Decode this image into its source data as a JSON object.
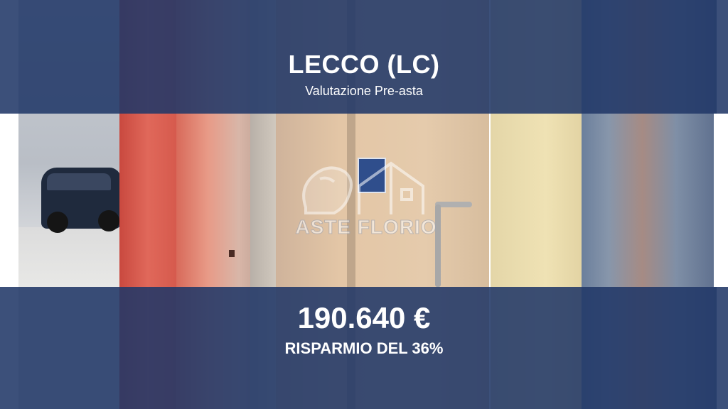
{
  "listing": {
    "location": "LECCO (LC)",
    "subtitle": "Valutazione Pre-asta",
    "price": "190.640 €",
    "saving": "RISPARMIO DEL 36%"
  },
  "watermark": {
    "brand": "ASTE FLORIO",
    "icon": "lion-house-logo"
  },
  "colors": {
    "band": "#213868",
    "text": "#ffffff"
  }
}
